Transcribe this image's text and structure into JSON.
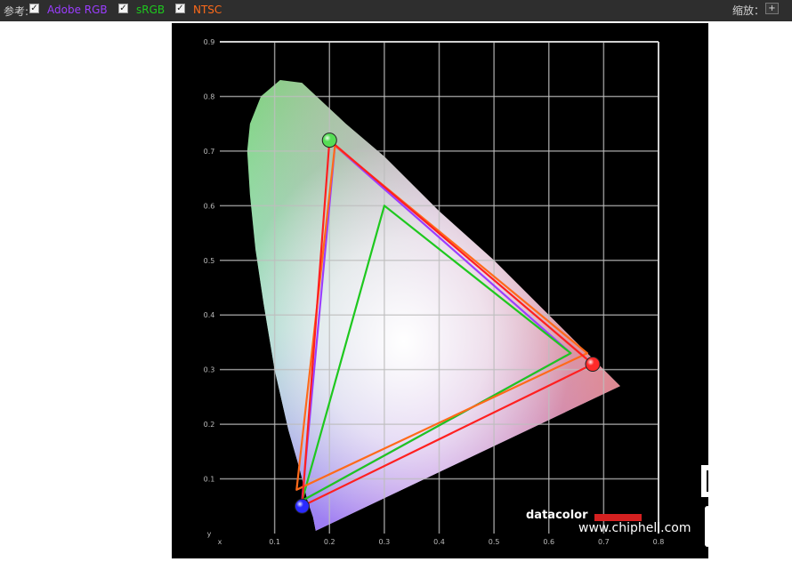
{
  "toolbar": {
    "reference_label": "参考:",
    "zoom_label": "缩放：",
    "zoom_button": "+",
    "legend": [
      {
        "label": "Adobe RGB",
        "checked": true,
        "color": "#9b3dff"
      },
      {
        "label": "sRGB",
        "checked": true,
        "color": "#1ec81e"
      },
      {
        "label": "NTSC",
        "checked": true,
        "color": "#ff6a1a"
      }
    ]
  },
  "chart_data": {
    "type": "scatter",
    "title": "",
    "xlabel": "",
    "ylabel": "",
    "xlim": [
      0,
      0.8
    ],
    "ylim": [
      0,
      0.9
    ],
    "grid": true,
    "xticks": [
      "x",
      "0.1",
      "0.2",
      "0.3",
      "0.4",
      "0.5",
      "0.6",
      "0.7",
      "0.8"
    ],
    "yticks": [
      "y",
      "0.1",
      "0.2",
      "0.3",
      "0.4",
      "0.5",
      "0.6",
      "0.7",
      "0.8",
      "0.9"
    ],
    "series": [
      {
        "name": "Adobe RGB",
        "color": "#9b3dff",
        "x": [
          0.64,
          0.21,
          0.15
        ],
        "y": [
          0.33,
          0.71,
          0.06
        ]
      },
      {
        "name": "sRGB",
        "color": "#1ec81e",
        "x": [
          0.64,
          0.3,
          0.15
        ],
        "y": [
          0.33,
          0.6,
          0.06
        ]
      },
      {
        "name": "NTSC",
        "color": "#ff6a1a",
        "x": [
          0.67,
          0.21,
          0.14
        ],
        "y": [
          0.33,
          0.71,
          0.08
        ]
      },
      {
        "color": "#ff2020",
        "x": [
          0.68,
          0.2,
          0.15
        ],
        "y": [
          0.31,
          0.72,
          0.05
        ]
      }
    ],
    "primaries": [
      {
        "color": "#ff2a2a",
        "x": 0.68,
        "y": 0.31
      },
      {
        "color": "#55dd55",
        "x": 0.2,
        "y": 0.72
      },
      {
        "color": "#2a2aff",
        "x": 0.15,
        "y": 0.05
      }
    ],
    "brand": "datacolor"
  },
  "watermark": {
    "url": "www.chiphell.com",
    "logo": "chiphell"
  }
}
